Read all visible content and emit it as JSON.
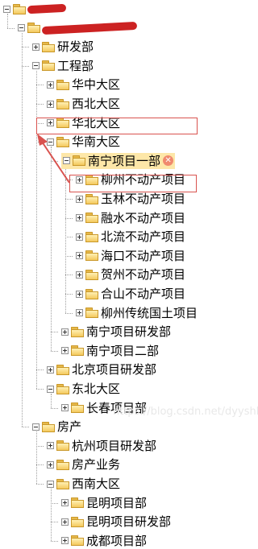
{
  "tree": {
    "nodes": [
      {
        "label": "",
        "depth": 0,
        "expanded": true,
        "scribbled": true
      },
      {
        "label": "",
        "depth": 1,
        "expanded": true,
        "scribbled": true
      },
      {
        "label": "研发部",
        "depth": 2,
        "expanded": false
      },
      {
        "label": "工程部",
        "depth": 2,
        "expanded": true
      },
      {
        "label": "华中大区",
        "depth": 3,
        "expanded": false
      },
      {
        "label": "西北大区",
        "depth": 3,
        "expanded": false
      },
      {
        "label": "华北大区",
        "depth": 3,
        "expanded": false
      },
      {
        "label": "华南大区",
        "depth": 3,
        "expanded": true
      },
      {
        "label": "南宁项目一部",
        "depth": 4,
        "expanded": true,
        "selected": true,
        "highlight": true,
        "delete_icon": true
      },
      {
        "label": "柳州不动产项目",
        "depth": 5,
        "expanded": false
      },
      {
        "label": "玉林不动产项目",
        "depth": 5,
        "expanded": false
      },
      {
        "label": "融水不动产项目",
        "depth": 5,
        "expanded": false
      },
      {
        "label": "北流不动产项目",
        "depth": 5,
        "expanded": false,
        "highlight": true
      },
      {
        "label": "海口不动产项目",
        "depth": 5,
        "expanded": false
      },
      {
        "label": "贺州不动产项目",
        "depth": 5,
        "expanded": false
      },
      {
        "label": "合山不动产项目",
        "depth": 5,
        "expanded": false
      },
      {
        "label": "柳州传统国土项目",
        "depth": 5,
        "expanded": false
      },
      {
        "label": "南宁项目研发部",
        "depth": 4,
        "expanded": false
      },
      {
        "label": "南宁项目二部",
        "depth": 4,
        "expanded": false
      },
      {
        "label": "北京项目研发部",
        "depth": 3,
        "expanded": false
      },
      {
        "label": "东北大区",
        "depth": 3,
        "expanded": true
      },
      {
        "label": "长春项目部",
        "depth": 4,
        "expanded": false
      },
      {
        "label": "房产",
        "depth": 2,
        "expanded": true
      },
      {
        "label": "杭州项目研发部",
        "depth": 3,
        "expanded": false
      },
      {
        "label": "房产业务",
        "depth": 3,
        "expanded": false
      },
      {
        "label": "西南大区",
        "depth": 3,
        "expanded": true
      },
      {
        "label": "昆明项目部",
        "depth": 4,
        "expanded": false
      },
      {
        "label": "昆明项目研发部",
        "depth": 4,
        "expanded": false
      },
      {
        "label": "成都项目部",
        "depth": 4,
        "expanded": false
      }
    ]
  },
  "delete_icon": "delete-icon",
  "watermark": "https://blog.csdn.net/dyyshb",
  "colors": {
    "highlight_border": "#d9534f",
    "arrow": "#d9534f",
    "scribble": "#cc2222",
    "folder": "#f4c95d"
  }
}
